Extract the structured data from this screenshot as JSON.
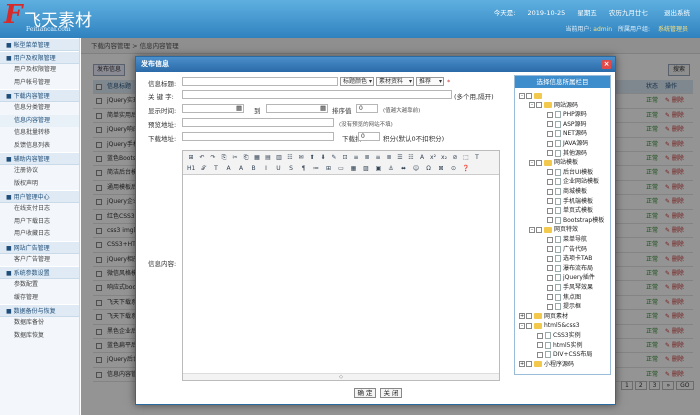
{
  "header": {
    "logo_mark": "F",
    "logo_text": "飞天素材",
    "logo_sub": "Feitiancai.com",
    "date_label": "今天是:",
    "date": "2019-10-25",
    "weekday": "星期五",
    "lunar": "农历九月廿七",
    "logout": "退出系统",
    "user_prefix": "当前用户:",
    "user": "admin",
    "role_prefix": "所属用户组:",
    "role": "系统管理员"
  },
  "sidebar": [
    {
      "type": "group",
      "label": "■ 帐型菜单管理"
    },
    {
      "type": "group",
      "label": "■ 用户及权限管理"
    },
    {
      "type": "item",
      "label": "用户及权限管理"
    },
    {
      "type": "item",
      "label": "用户帐号管理"
    },
    {
      "type": "group",
      "label": "■ 下载内容管理"
    },
    {
      "type": "item",
      "label": "信息分类管理"
    },
    {
      "type": "item",
      "label": "信息内容管理",
      "active": true
    },
    {
      "type": "item",
      "label": "信息批量转移"
    },
    {
      "type": "item",
      "label": "反馈信息列表"
    },
    {
      "type": "group",
      "label": "■ 辅助内容管理"
    },
    {
      "type": "item",
      "label": "注册协议"
    },
    {
      "type": "item",
      "label": "版权声明"
    },
    {
      "type": "group",
      "label": "■ 用户管理中心"
    },
    {
      "type": "item",
      "label": "在线支付日志"
    },
    {
      "type": "item",
      "label": "用户下载日志"
    },
    {
      "type": "item",
      "label": "用户收藏日志"
    },
    {
      "type": "group",
      "label": "■ 网站广告管理"
    },
    {
      "type": "item",
      "label": "客户广告管理"
    },
    {
      "type": "group",
      "label": "■ 系统参数设置"
    },
    {
      "type": "item",
      "label": "参数配置"
    },
    {
      "type": "item",
      "label": "缓存管理"
    },
    {
      "type": "group",
      "label": "■ 数据备份与恢复"
    },
    {
      "type": "item",
      "label": "数据库备份"
    },
    {
      "type": "item",
      "label": "数据库恢复"
    }
  ],
  "main": {
    "breadcrumb": "下载内容管理 > 信息内容管理",
    "add_button": "发布信息",
    "search_button": "搜索",
    "table_head": {
      "title": "信息标题",
      "status": "状态",
      "op": "操作"
    },
    "rows": [
      {
        "title": "jQuery实现",
        "status": "正常",
        "op": "✎ 删除"
      },
      {
        "title": "简单实用后台",
        "status": "正常",
        "op": "✎ 删除"
      },
      {
        "title": "jQuery响应式",
        "status": "正常",
        "op": "✎ 删除"
      },
      {
        "title": "jQuery手机",
        "status": "正常",
        "op": "✎ 删除"
      },
      {
        "title": "蓝色Bootst",
        "status": "正常",
        "op": "✎ 删除"
      },
      {
        "title": "简洁后台模",
        "status": "正常",
        "op": "✎ 删除"
      },
      {
        "title": "通用模板后",
        "status": "正常",
        "op": "✎ 删除"
      },
      {
        "title": "jQuery企业",
        "status": "正常",
        "op": "✎ 删除"
      },
      {
        "title": "红色CSS3",
        "status": "正常",
        "op": "✎ 删除"
      },
      {
        "title": "css3 img图",
        "status": "正常",
        "op": "✎ 删除"
      },
      {
        "title": "CSS3+HTML",
        "status": "正常",
        "op": "✎ 删除"
      },
      {
        "title": "jQuery相册",
        "status": "正常",
        "op": "✎ 删除"
      },
      {
        "title": "微信风格模",
        "status": "正常",
        "op": "✎ 删除"
      },
      {
        "title": "响应式bootst",
        "status": "正常",
        "op": "✎ 删除"
      },
      {
        "title": "飞天下载系",
        "status": "正常",
        "op": "✎ 删除"
      },
      {
        "title": "飞天下载系",
        "status": "正常",
        "op": "✎ 删除"
      },
      {
        "title": "黑色企业后",
        "status": "正常",
        "op": "✎ 删除"
      },
      {
        "title": "蓝色扁平后",
        "status": "正常",
        "op": "✎ 删除"
      },
      {
        "title": "jQuery后台",
        "status": "正常",
        "op": "✎ 删除"
      },
      {
        "title": "信息内容管理",
        "status": "正常",
        "op": "✎ 删除"
      }
    ],
    "pager": [
      "1",
      "2",
      "3",
      "»",
      "GO"
    ]
  },
  "modal": {
    "title": "发布信息",
    "close": "×",
    "title_label": "信息标题:",
    "title_color": "标题颜色",
    "material": "素材资料",
    "recommend": "推荐",
    "required": "*",
    "keyword_label": "关 键 字:",
    "keyword_hint": "(多个用,隔开)",
    "display_time_label": "显示时间:",
    "to": "到",
    "sort_label": "排序值",
    "sort_value": "0",
    "sort_hint": "(值越大越靠前)",
    "preview_label": "预览地址:",
    "preview_hint": "(没有预览的网站不填)",
    "download_label": "下载地址:",
    "points_label": "下载扣",
    "points_value": "0",
    "points_hint": "积分(默认0不扣积分)",
    "content_label": "信息内容:",
    "editor_status": "◇",
    "ok": "确 定",
    "cancel": "关 闭",
    "toolbar1": [
      "⊞",
      "↶",
      "↷",
      "⎘",
      "✂",
      "⎗",
      "▦",
      "▤",
      "▥",
      "☷",
      "✉",
      "⬆",
      "⬇",
      "✎",
      "⊡",
      "≡",
      "≣",
      "≡",
      "≣",
      "☰",
      "☷",
      "A",
      "x²",
      "x₂",
      "⊘",
      "⬚",
      "T"
    ],
    "toolbar2": [
      "H1",
      "𝒯",
      "T",
      "A",
      "A",
      "B",
      "I",
      "U",
      "S",
      "¶",
      "≔",
      "⊞",
      "▭",
      "▦",
      "▨",
      "▣",
      "⚓",
      "⬌",
      "☺",
      "Ω",
      "⊠",
      "⊙",
      "❓"
    ]
  },
  "categories": {
    "header": "选择信息所属栏目",
    "nodes": [
      {
        "label": "",
        "level": 0,
        "kind": "folder",
        "exp": "-"
      },
      {
        "label": "网站源码",
        "level": 1,
        "kind": "folder",
        "exp": "-"
      },
      {
        "label": "PHP源码",
        "level": 2,
        "kind": "file"
      },
      {
        "label": "ASP源码",
        "level": 2,
        "kind": "file"
      },
      {
        "label": "NET源码",
        "level": 2,
        "kind": "file"
      },
      {
        "label": "JAVA源码",
        "level": 2,
        "kind": "file"
      },
      {
        "label": "其他源码",
        "level": 2,
        "kind": "file"
      },
      {
        "label": "网站模板",
        "level": 1,
        "kind": "folder",
        "exp": "-"
      },
      {
        "label": "后台UI模板",
        "level": 2,
        "kind": "file"
      },
      {
        "label": "企业网站模板",
        "level": 2,
        "kind": "file"
      },
      {
        "label": "商城模板",
        "level": 2,
        "kind": "file"
      },
      {
        "label": "手机端模板",
        "level": 2,
        "kind": "file"
      },
      {
        "label": "单页式模板",
        "level": 2,
        "kind": "file"
      },
      {
        "label": "Bootstrap模板",
        "level": 2,
        "kind": "file"
      },
      {
        "label": "网页特效",
        "level": 1,
        "kind": "folder",
        "exp": "-"
      },
      {
        "label": "菜单导航",
        "level": 2,
        "kind": "file"
      },
      {
        "label": "广告代码",
        "level": 2,
        "kind": "file"
      },
      {
        "label": "选项卡TAB",
        "level": 2,
        "kind": "file"
      },
      {
        "label": "瀑布流布局",
        "level": 2,
        "kind": "file"
      },
      {
        "label": "jQuery插件",
        "level": 2,
        "kind": "file"
      },
      {
        "label": "手风琴效果",
        "level": 2,
        "kind": "file"
      },
      {
        "label": "焦点图",
        "level": 2,
        "kind": "file"
      },
      {
        "label": "提示框",
        "level": 2,
        "kind": "file"
      },
      {
        "label": "网页素材",
        "level": 0,
        "kind": "folder",
        "exp": "+"
      },
      {
        "label": "html5&css3",
        "level": 0,
        "kind": "folder",
        "exp": "-"
      },
      {
        "label": "CSS3实例",
        "level": 1,
        "kind": "file"
      },
      {
        "label": "html5实例",
        "level": 1,
        "kind": "file"
      },
      {
        "label": "DIV+CSS布局",
        "level": 1,
        "kind": "file"
      },
      {
        "label": "小程序源码",
        "level": 0,
        "kind": "folder",
        "exp": "+"
      }
    ]
  }
}
